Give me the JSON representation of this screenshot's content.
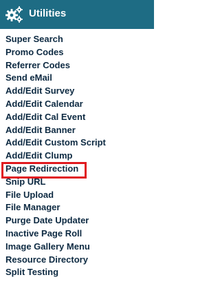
{
  "header": {
    "title": "Utilities",
    "icon": "gears-icon",
    "background": "#1e6c84"
  },
  "menu": {
    "items": [
      {
        "label": "Super Search"
      },
      {
        "label": "Promo Codes"
      },
      {
        "label": "Referrer Codes"
      },
      {
        "label": "Send eMail"
      },
      {
        "label": "Add/Edit Survey"
      },
      {
        "label": "Add/Edit Calendar"
      },
      {
        "label": "Add/Edit Cal Event"
      },
      {
        "label": "Add/Edit Banner"
      },
      {
        "label": "Add/Edit Custom Script"
      },
      {
        "label": "Add/Edit Clump"
      },
      {
        "label": "Page Redirection",
        "highlighted": true
      },
      {
        "label": "Snip URL"
      },
      {
        "label": "File Upload"
      },
      {
        "label": "File Manager"
      },
      {
        "label": "Purge Date Updater"
      },
      {
        "label": "Inactive Page Roll"
      },
      {
        "label": "Image Gallery Menu"
      },
      {
        "label": "Resource Directory"
      },
      {
        "label": "Split Testing"
      }
    ]
  },
  "colors": {
    "item_text": "#0d2a42",
    "highlight_border": "#e0191e"
  }
}
